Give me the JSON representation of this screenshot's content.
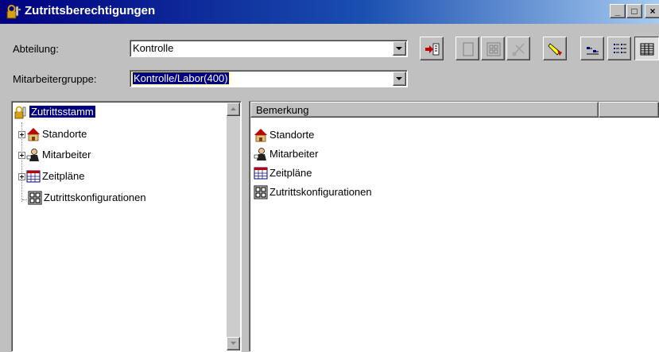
{
  "window": {
    "title": "Zutrittsberechtigungen",
    "title_icon": "keys-icon",
    "controls": [
      "minimize",
      "maximize",
      "close"
    ],
    "control_glyphs": {
      "minimize": "_",
      "maximize": "□",
      "close": "×"
    }
  },
  "form": {
    "abteilung_label": "Abteilung:",
    "abteilung_value": "Kontrolle",
    "gruppe_label": "Mitarbeitergruppe:",
    "gruppe_value": "Kontrolle/Labor(400)"
  },
  "toolbar": {
    "buttons": [
      {
        "icon": "enter-arrow-icon",
        "enabled": true
      },
      {
        "icon": "blank-page-icon",
        "enabled": false
      },
      {
        "icon": "grid-properties-icon",
        "enabled": false
      },
      {
        "icon": "cut-icon",
        "enabled": false
      },
      {
        "icon": "highlighter-icon",
        "enabled": true
      },
      {
        "icon": "small-icons-view-icon",
        "enabled": true
      },
      {
        "icon": "list-view-icon",
        "enabled": true
      },
      {
        "icon": "details-view-icon",
        "enabled": true,
        "pressed": true
      }
    ]
  },
  "tree": {
    "root": {
      "label": "Zutrittsstamm",
      "icon": "keys-icon",
      "selected": true
    },
    "children": [
      {
        "label": "Standorte",
        "icon": "house-icon",
        "expandable": true
      },
      {
        "label": "Mitarbeiter",
        "icon": "person-icon",
        "expandable": true
      },
      {
        "label": "Zeitpläne",
        "icon": "calendar-icon",
        "expandable": true
      },
      {
        "label": "Zutrittskonfigurationen",
        "icon": "config-grid-icon",
        "expandable": false
      }
    ]
  },
  "list": {
    "columns": [
      "Bemerkung",
      ""
    ],
    "items": [
      {
        "label": "Standorte",
        "icon": "house-icon"
      },
      {
        "label": "Mitarbeiter",
        "icon": "person-icon"
      },
      {
        "label": "Zeitpläne",
        "icon": "calendar-icon"
      },
      {
        "label": "Zutrittskonfigurationen",
        "icon": "config-grid-icon"
      }
    ]
  },
  "colors": {
    "titlebar_start": "#000080",
    "titlebar_end": "#a6caf0",
    "selection": "#000080",
    "house_roof": "#c00000",
    "face": "#c0c0c0"
  }
}
